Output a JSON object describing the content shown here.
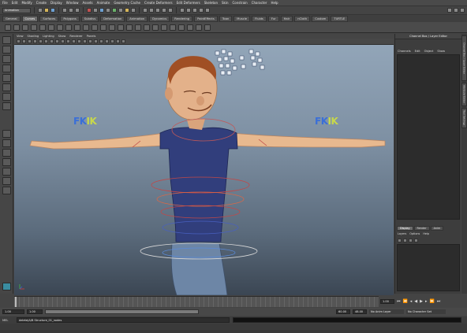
{
  "app": {
    "accent": "#6d9fd0"
  },
  "menubar": {
    "items": [
      "File",
      "Edit",
      "Modify",
      "Create",
      "Display",
      "Window",
      "Assets",
      "Animate",
      "Geometry Cache",
      "Create Deformers",
      "Edit Deformers",
      "Skeleton",
      "Skin",
      "Constrain",
      "Character",
      "Help"
    ]
  },
  "statusline": {
    "mode": "Animation"
  },
  "shelf": {
    "tabs": [
      "General",
      "Curves",
      "Surfaces",
      "Polygons",
      "Subdivs",
      "Deformation",
      "Animation",
      "Dynamics",
      "Rendering",
      "PaintEffects",
      "Toon",
      "Muscle",
      "Fluids",
      "Fur",
      "Hair",
      "nCloth",
      "Custom",
      "TURTLE"
    ],
    "active_index": 1
  },
  "viewport": {
    "menu": [
      "View",
      "Shading",
      "Lighting",
      "Show",
      "Renderer",
      "Panels"
    ],
    "fk_left": "FK",
    "ik_left": "IK",
    "fk_right": "FK",
    "ik_right": "IK",
    "fk_color": "#3a6fd8",
    "ik_color": "#c8d84a"
  },
  "channelbox": {
    "title": "Channel Box / Layer Editor",
    "menu": [
      "Channels",
      "Edit",
      "Object",
      "Show"
    ],
    "layer_tabs": [
      "Display",
      "Render",
      "Anim"
    ],
    "layer_menu": [
      "Layers",
      "Options",
      "Help"
    ]
  },
  "side_tabs": [
    "Channel Box / Layer Editor",
    "Attribute Editor",
    "Tool Settings"
  ],
  "timeslider": {
    "current_frame": "1.00",
    "start": "1.00",
    "range_start": "1.00",
    "range_end": "60.00",
    "end": "48.00"
  },
  "options": {
    "anim_layer": "No Anim Layer",
    "character_set": "No Character Set"
  },
  "commandline": {
    "lang": "MEL",
    "text": "delete(A/B Structure_01_nodes"
  }
}
